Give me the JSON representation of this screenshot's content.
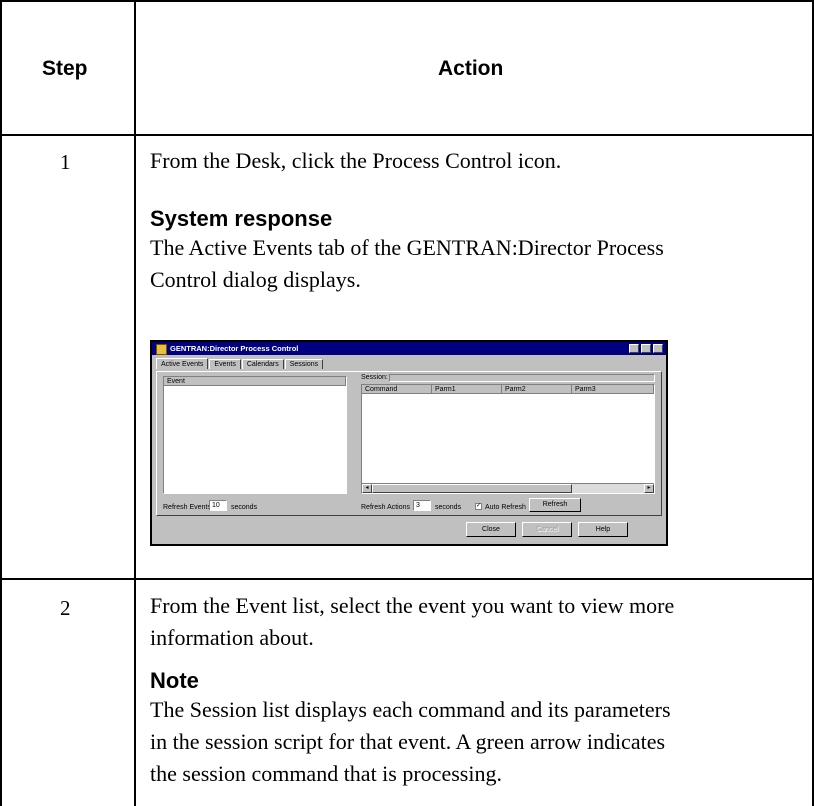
{
  "table": {
    "headers": {
      "step": "Step",
      "action": "Action"
    },
    "rows": [
      {
        "step": "1",
        "action_text": "From the Desk, click the Process Control icon.",
        "subhead": "System response",
        "response_line1": "The Active Events tab of the GENTRAN:Director Process",
        "response_line2": "Control dialog displays."
      },
      {
        "step": "2",
        "action_line1": "From the Event list, select the event you want to view more",
        "action_line2": "information about.",
        "subhead": "Note",
        "note_line1": "The Session list displays each command and its parameters",
        "note_line2": "in the session script for that event. A green arrow indicates",
        "note_line3": "the session command that is processing."
      }
    ]
  },
  "dialog": {
    "title": "GENTRAN:Director Process Control",
    "icons": {
      "app": "app-icon",
      "minimize": "minimize-icon",
      "maximize": "maximize-icon",
      "close": "close-icon"
    },
    "tabs": [
      "Active Events",
      "Events",
      "Calendars",
      "Sessions"
    ],
    "event_list_header": "Event",
    "session_label": "Session:",
    "session_columns": [
      "Command",
      "Parm1",
      "Parm2",
      "Parm3"
    ],
    "refresh_events_label": "Refresh Events",
    "refresh_events_value": "10",
    "refresh_events_units": "seconds",
    "refresh_actions_label": "Refresh Actions",
    "refresh_actions_value": "3",
    "refresh_actions_units": "seconds",
    "auto_refresh_label": "Auto Refresh",
    "auto_refresh_checked": true,
    "refresh_button": "Refresh",
    "close_button": "Close",
    "cancel_button": "Cancel",
    "help_button": "Help"
  }
}
